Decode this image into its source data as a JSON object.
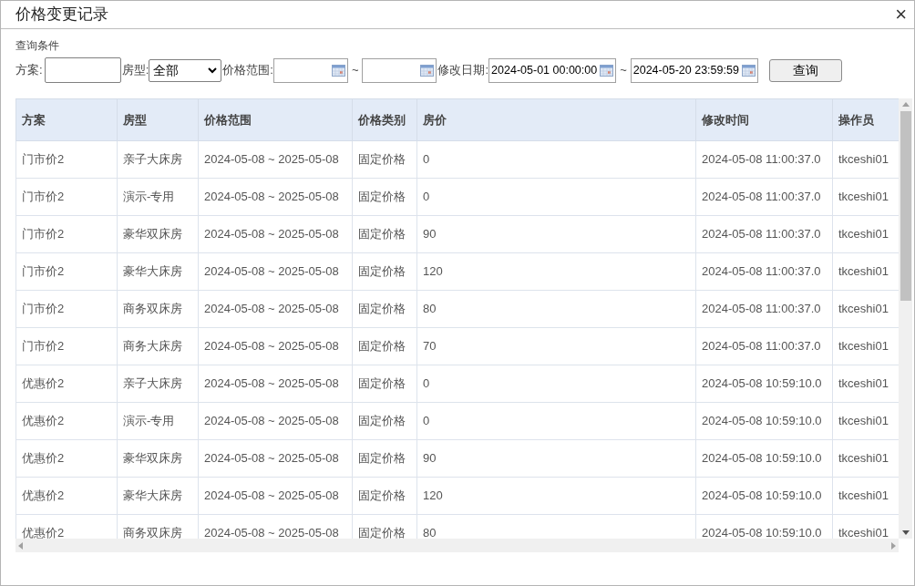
{
  "window": {
    "title": "价格变更记录",
    "close": "×"
  },
  "filters": {
    "section_label": "查询条件",
    "plan": {
      "label": "方案:"
    },
    "room_type": {
      "label": "房型:",
      "value": "全部"
    },
    "price_range": {
      "label": "价格范围:",
      "separator": "~"
    },
    "modified_date": {
      "label": "修改日期:",
      "from": "2024-05-01 00:00:00",
      "separator": "~",
      "to": "2024-05-20 23:59:59"
    },
    "query_button": "查询"
  },
  "table": {
    "columns": [
      "方案",
      "房型",
      "价格范围",
      "价格类别",
      "房价",
      "修改时间",
      "操作员"
    ],
    "rows": [
      [
        "门市价2",
        "亲子大床房",
        "2024-05-08 ~ 2025-05-08",
        "固定价格",
        "0",
        "2024-05-08 11:00:37.0",
        "tkceshi01"
      ],
      [
        "门市价2",
        "演示-专用",
        "2024-05-08 ~ 2025-05-08",
        "固定价格",
        "0",
        "2024-05-08 11:00:37.0",
        "tkceshi01"
      ],
      [
        "门市价2",
        "豪华双床房",
        "2024-05-08 ~ 2025-05-08",
        "固定价格",
        "90",
        "2024-05-08 11:00:37.0",
        "tkceshi01"
      ],
      [
        "门市价2",
        "豪华大床房",
        "2024-05-08 ~ 2025-05-08",
        "固定价格",
        "120",
        "2024-05-08 11:00:37.0",
        "tkceshi01"
      ],
      [
        "门市价2",
        "商务双床房",
        "2024-05-08 ~ 2025-05-08",
        "固定价格",
        "80",
        "2024-05-08 11:00:37.0",
        "tkceshi01"
      ],
      [
        "门市价2",
        "商务大床房",
        "2024-05-08 ~ 2025-05-08",
        "固定价格",
        "70",
        "2024-05-08 11:00:37.0",
        "tkceshi01"
      ],
      [
        "优惠价2",
        "亲子大床房",
        "2024-05-08 ~ 2025-05-08",
        "固定价格",
        "0",
        "2024-05-08 10:59:10.0",
        "tkceshi01"
      ],
      [
        "优惠价2",
        "演示-专用",
        "2024-05-08 ~ 2025-05-08",
        "固定价格",
        "0",
        "2024-05-08 10:59:10.0",
        "tkceshi01"
      ],
      [
        "优惠价2",
        "豪华双床房",
        "2024-05-08 ~ 2025-05-08",
        "固定价格",
        "90",
        "2024-05-08 10:59:10.0",
        "tkceshi01"
      ],
      [
        "优惠价2",
        "豪华大床房",
        "2024-05-08 ~ 2025-05-08",
        "固定价格",
        "120",
        "2024-05-08 10:59:10.0",
        "tkceshi01"
      ],
      [
        "优惠价2",
        "商务双床房",
        "2024-05-08 ~ 2025-05-08",
        "固定价格",
        "80",
        "2024-05-08 10:59:10.0",
        "tkceshi01"
      ]
    ]
  }
}
